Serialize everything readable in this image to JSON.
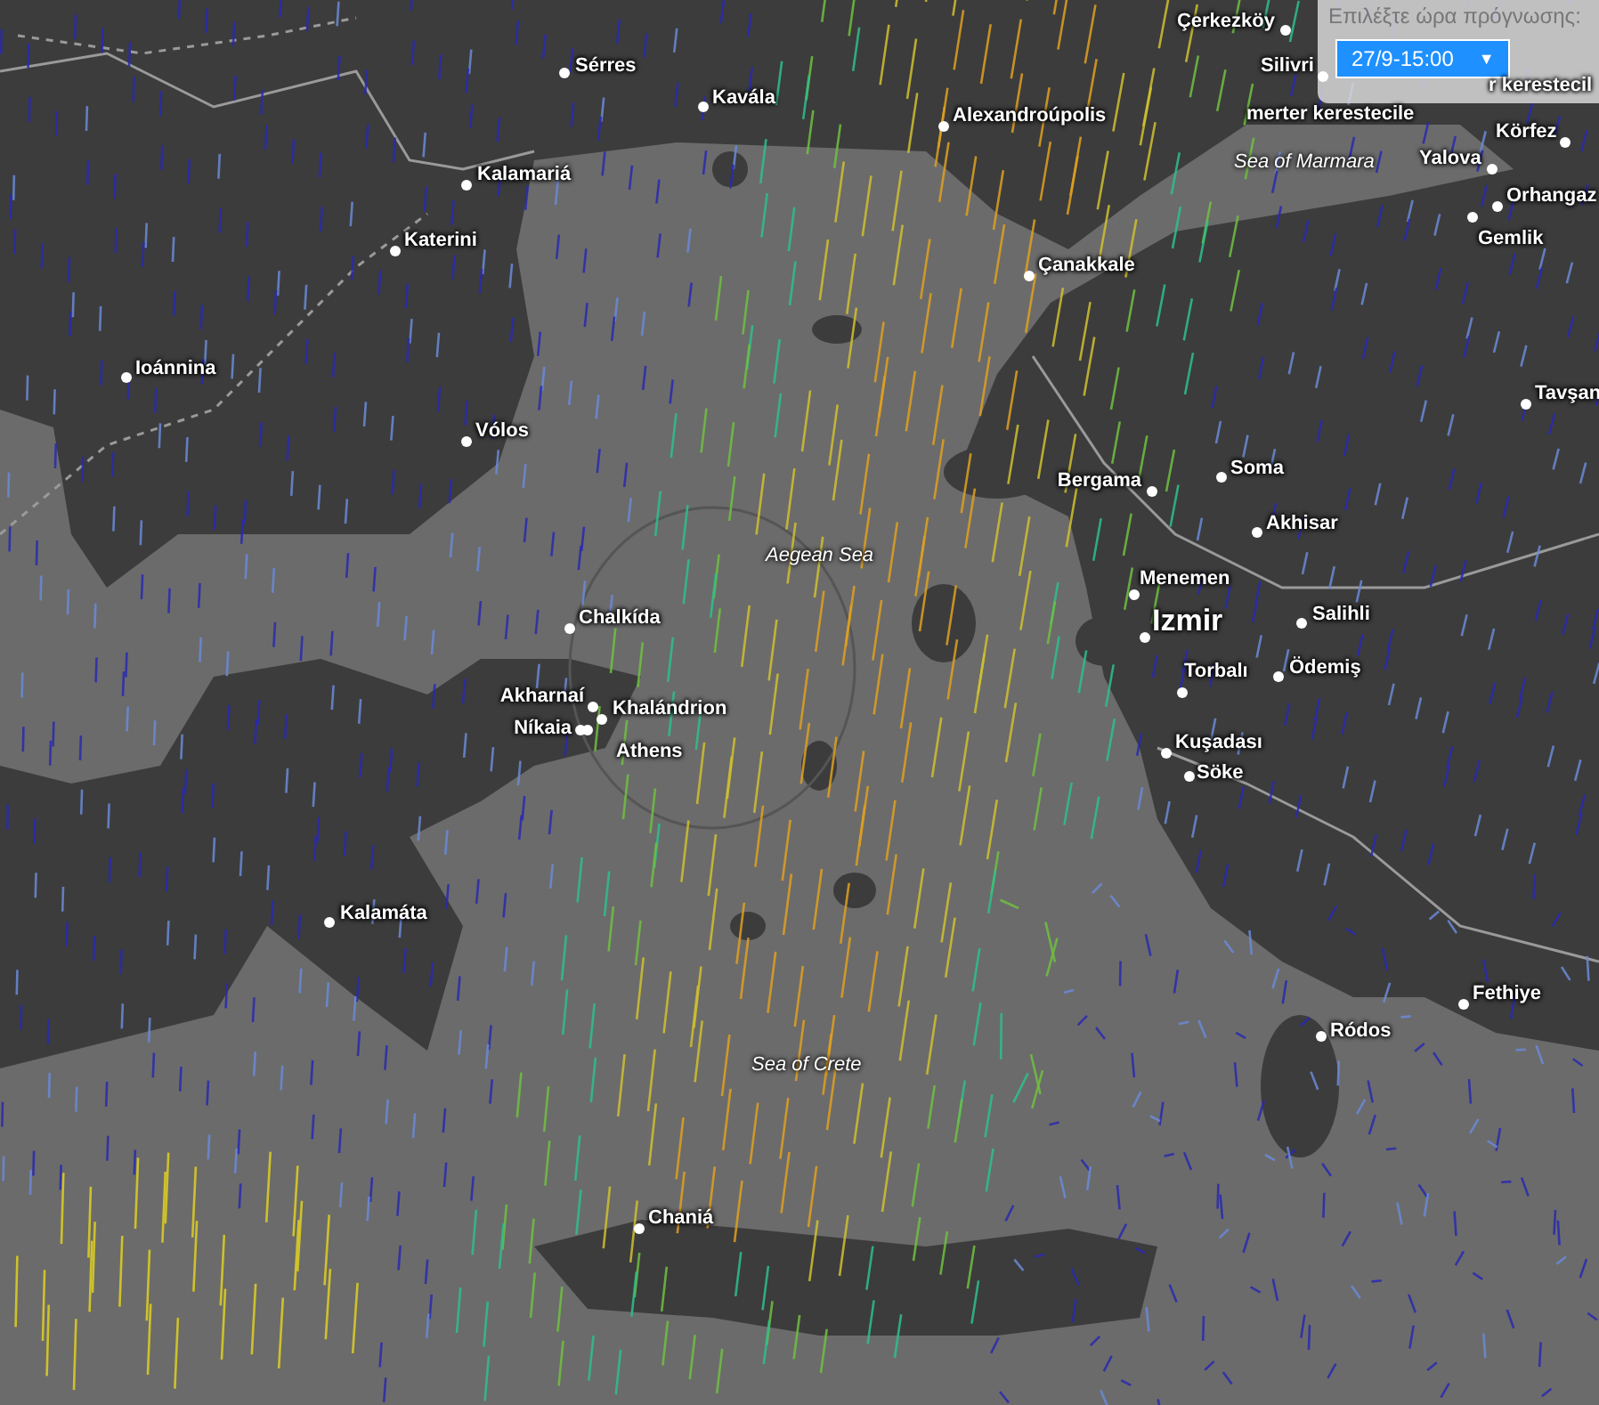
{
  "forecast_picker": {
    "label": "Επιλέξτε ώρα πρόγνωσης:",
    "value": "27/9-15:00",
    "caret": "▼"
  },
  "places": [
    {
      "name": "Çerkezköy",
      "kind": "town"
    },
    {
      "name": "Silivri",
      "kind": "town"
    },
    {
      "name": "r kerestecil",
      "kind": "place"
    },
    {
      "name": "merter kerestecile",
      "kind": "place"
    },
    {
      "name": "Körfez",
      "kind": "town"
    },
    {
      "name": "Yalova",
      "kind": "town"
    },
    {
      "name": "Orhangaz",
      "kind": "town"
    },
    {
      "name": "Gemlik",
      "kind": "town"
    },
    {
      "name": "Sérres",
      "kind": "town"
    },
    {
      "name": "Kavála",
      "kind": "town"
    },
    {
      "name": "Alexandroúpolis",
      "kind": "town"
    },
    {
      "name": "Kalamariá",
      "kind": "town"
    },
    {
      "name": "Katerini",
      "kind": "town"
    },
    {
      "name": "Çanakkale",
      "kind": "town"
    },
    {
      "name": "Ioánnina",
      "kind": "town"
    },
    {
      "name": "Tavşan",
      "kind": "town"
    },
    {
      "name": "Vólos",
      "kind": "town"
    },
    {
      "name": "Bergama",
      "kind": "town"
    },
    {
      "name": "Soma",
      "kind": "town"
    },
    {
      "name": "Akhisar",
      "kind": "town"
    },
    {
      "name": "Menemen",
      "kind": "town"
    },
    {
      "name": "Izmir",
      "kind": "major"
    },
    {
      "name": "Salihli",
      "kind": "town"
    },
    {
      "name": "Torbalı",
      "kind": "town"
    },
    {
      "name": "Ödemiş",
      "kind": "town"
    },
    {
      "name": "Chalkída",
      "kind": "town"
    },
    {
      "name": "Akharnaí",
      "kind": "town"
    },
    {
      "name": "Khalándrion",
      "kind": "town"
    },
    {
      "name": "Níkaia",
      "kind": "town"
    },
    {
      "name": "Athens",
      "kind": "town"
    },
    {
      "name": "Kuşadası",
      "kind": "town"
    },
    {
      "name": "Söke",
      "kind": "town"
    },
    {
      "name": "Kalamáta",
      "kind": "town"
    },
    {
      "name": "Fethiye",
      "kind": "town"
    },
    {
      "name": "Ródos",
      "kind": "town"
    },
    {
      "name": "Chaniá",
      "kind": "town"
    }
  ],
  "seas": [
    "Sea of Marmara",
    "Aegean Sea",
    "Sea of Crete"
  ]
}
